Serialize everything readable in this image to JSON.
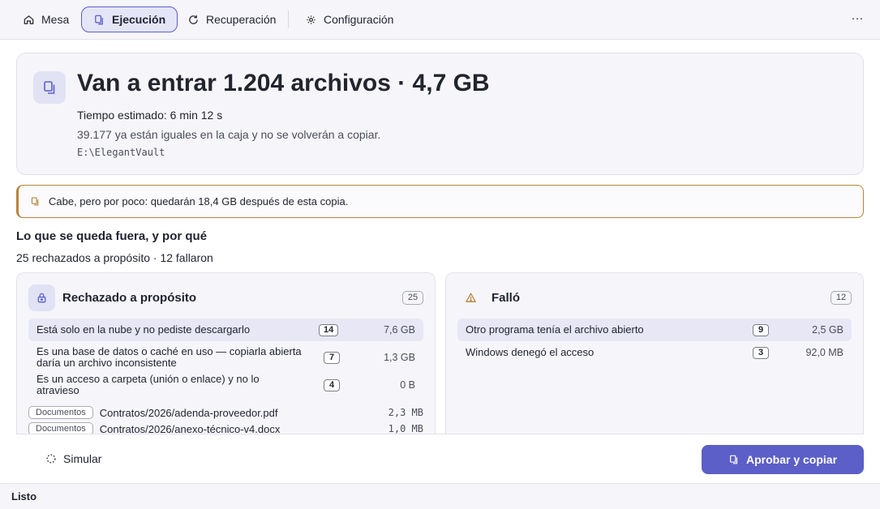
{
  "nav": {
    "tabs": [
      {
        "label": "Mesa",
        "icon": "home-icon"
      },
      {
        "label": "Ejecución",
        "icon": "copy-icon",
        "active": true
      },
      {
        "label": "Recuperación",
        "icon": "refresh-icon"
      },
      {
        "label": "Configuración",
        "icon": "settings-icon"
      }
    ],
    "more_label": "···"
  },
  "hero": {
    "title": "Van a entrar 1.204 archivos · 4,7 GB",
    "eta": "Tiempo estimado: 6 min 12 s",
    "same": "39.177 ya están iguales en la caja y no se volverán a copiar.",
    "path": "E:\\ElegantVault"
  },
  "warning": {
    "text": "Cabe, pero por poco: quedarán 18,4 GB después de esta copia."
  },
  "excluded": {
    "title": "Lo que se queda fuera, y por qué",
    "summary": "25 rechazados a propósito · 12 fallaron"
  },
  "rejected": {
    "title": "Rechazado a propósito",
    "count": "25",
    "reasons": [
      {
        "text": "Está solo en la nube y no pediste descargarlo",
        "count": "14",
        "size": "7,6 GB"
      },
      {
        "text": "Es una base de datos o caché en uso — copiarla abierta daría un archivo inconsistente",
        "count": "7",
        "size": "1,3 GB"
      },
      {
        "text": "Es un acceso a carpeta (unión o enlace) y no lo atravieso",
        "count": "4",
        "size": "0 B"
      }
    ],
    "files": [
      {
        "tag": "Documentos",
        "name": "Contratos/2026/adenda-proveedor.pdf",
        "size": "2,3 MB"
      },
      {
        "tag": "Documentos",
        "name": "Contratos/2026/anexo-técnico-v4.docx",
        "size": "1,0 MB"
      }
    ]
  },
  "failed": {
    "title": "Falló",
    "count": "12",
    "reasons": [
      {
        "text": "Otro programa tenía el archivo abierto",
        "count": "9",
        "size": "2,5 GB"
      },
      {
        "text": "Windows denegó el acceso",
        "count": "3",
        "size": "92,0 MB"
      }
    ]
  },
  "actions": {
    "simulate": "Simular",
    "approve": "Aprobar y copiar"
  },
  "status": "Listo",
  "colors": {
    "accent": "#5b5fc7",
    "warning": "#b8843a"
  }
}
